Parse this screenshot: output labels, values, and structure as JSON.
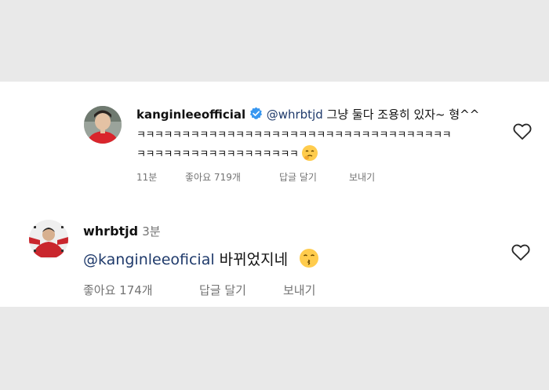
{
  "comment1": {
    "username": "kanginleeofficial",
    "mention": "@whrbtjd",
    "text_line1": " 그냥 둘다 조용히 있자~ 형^^",
    "text_line2": "ㅋㅋㅋㅋㅋㅋㅋㅋㅋㅋㅋㅋㅋㅋㅋㅋㅋㅋㅋㅋㅋㅋㅋㅋㅋㅋㅋㅋㅋㅋㅋㅋㅋㅋㅋ",
    "text_line3": "ㅋㅋㅋㅋㅋㅋㅋㅋㅋㅋㅋㅋㅋㅋㅋㅋㅋㅋ",
    "emoji_icon": "shushing-face-icon",
    "time": "11분",
    "likes": "좋아요 719개",
    "reply": "답글 달기",
    "send": "보내기"
  },
  "comment2": {
    "username": "whrbtjd",
    "time": "3분",
    "mention": "@kanginleeoficial",
    "text": " 바뀌었지네",
    "emoji_icon": "kissing-face-icon",
    "likes": "좋아요 174개",
    "reply": "답글 달기",
    "send": "보내기"
  },
  "colors": {
    "background": "#e9e9e9",
    "card": "#ffffff",
    "mention": "#1f3a6b",
    "meta": "#737373",
    "verified": "#3897f0"
  }
}
